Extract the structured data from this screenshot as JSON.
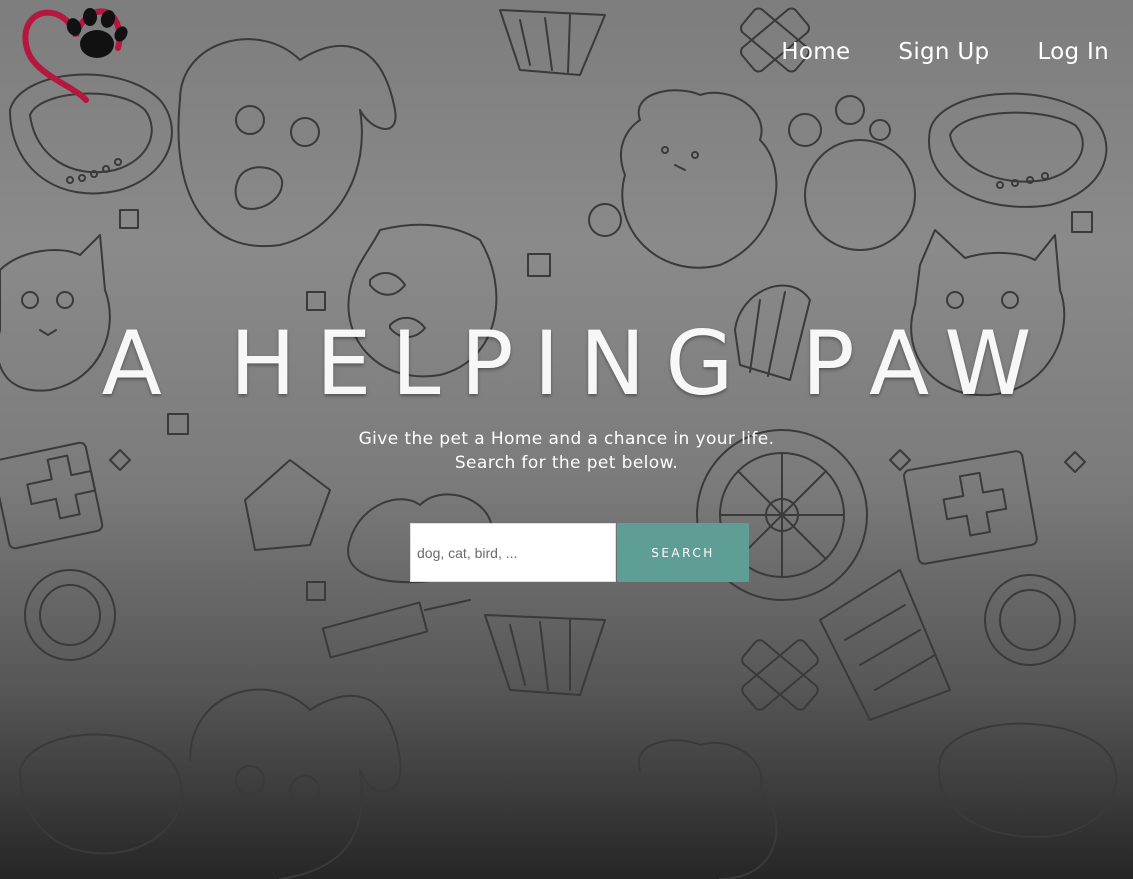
{
  "nav": {
    "items": [
      {
        "label": "Home"
      },
      {
        "label": "Sign Up"
      },
      {
        "label": "Log In"
      }
    ]
  },
  "hero": {
    "title": "A HELPING PAW",
    "tagline_line1": "Give the pet a Home and a chance in your life.",
    "tagline_line2": "Search for the pet below."
  },
  "search": {
    "placeholder": "dog, cat, bird, ...",
    "value": "",
    "button_label": "SEARCH"
  },
  "colors": {
    "accent": "#5e9e94",
    "logo_heart": "#b5173e",
    "logo_paw": "#111111"
  },
  "icons": {
    "logo": "heart-paw-logo-icon",
    "background": "pet-doodle-pattern"
  }
}
